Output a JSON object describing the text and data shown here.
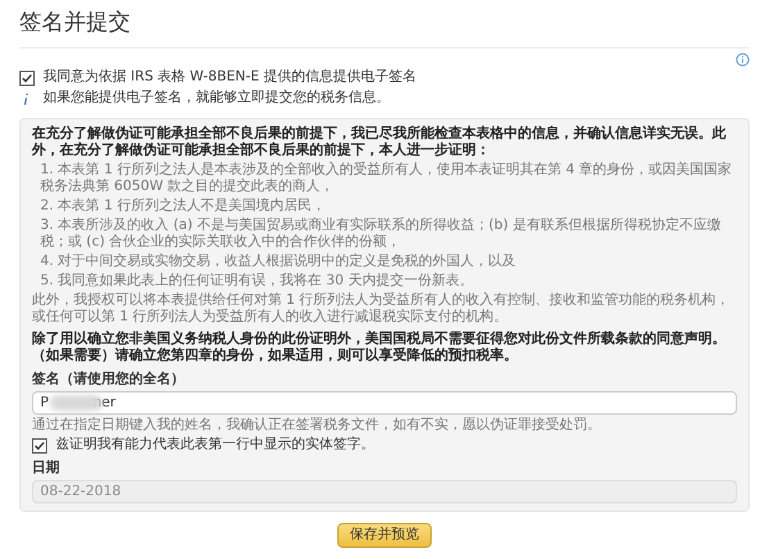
{
  "title": "签名并提交",
  "consent": {
    "label": "我同意为依据 IRS 表格 W-8BEN-E 提供的信息提供电子签名",
    "checked": true
  },
  "info_note": "如果您能提供电子签名，就能够立即提交您的税务信息。",
  "certification": {
    "intro": "在充分了解做伪证可能承担全部不良后果的前提下，我已尽我所能检查本表格中的信息，并确认信息详实无误。此外，在充分了解做伪证可能承担全部不良后果的前提下，本人进一步证明：",
    "items": [
      "1. 本表第 1 行所列之法人是本表涉及的全部收入的受益所有人，使用本表证明其在第 4 章的身份，或因美国国家税务法典第 6050W 款之目的提交此表的商人，",
      "2. 本表第 1 行所列之法人不是美国境内居民，",
      "3. 本表所涉及的收入 (a) 不是与美国贸易或商业有实际联系的所得收益；(b) 是有联系但根据所得税协定不应缴税；或 (c) 合伙企业的实际关联收入中的合作伙伴的份额，",
      "4. 对于中间交易或实物交易，收益人根据说明中的定义是免税的外国人，以及",
      "5. 我同意如果此表上的任何证明有误，我将在 30 天内提交一份新表。"
    ],
    "authorization": "此外，我授权可以将本表提供给任何对第 1 行所列法人为受益所有人的收入有控制、接收和监管功能的税务机构，或任何可以第 1 行所列法人为受益所有人的收入进行减退税实际支付的机构。",
    "notice": "除了用以确立您非美国义务纳税人身份的此份证明外，美国国税局不需要征得您对此份文件所载条款的同意声明。（如果需要）请确立您第四章的身份，如果适用，则可以享受降低的预扣税率。"
  },
  "signature": {
    "label": "签名（请使用您的全名）",
    "value": "P          ner",
    "hint": "通过在指定日期键入我的姓名，我确认正在签署税务文件，如有不实，愿以伪证罪接受处罚。"
  },
  "capacity": {
    "label": "兹证明我有能力代表此表第一行中显示的实体签字。",
    "checked": true
  },
  "date": {
    "label": "日期",
    "value": "08-22-2018",
    "disabled": true
  },
  "submit": "保存并预览"
}
